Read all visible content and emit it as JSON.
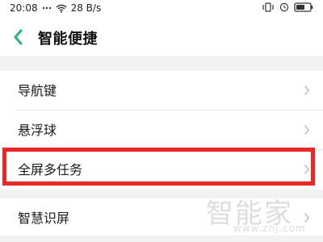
{
  "status_bar": {
    "time": "20:08",
    "network_speed": "28 B/s",
    "icons": [
      "more-dots-icon",
      "wifi-icon",
      "vibrate-icon",
      "alarm-icon",
      "battery-icon"
    ]
  },
  "header": {
    "title": "智能便捷",
    "back_icon": "back-arrow-icon",
    "accent_color": "#20b77a"
  },
  "settings": {
    "group_a": [
      {
        "label": "导航键",
        "name": "nav-key"
      },
      {
        "label": "悬浮球",
        "name": "floating-ball"
      },
      {
        "label": "全屏多任务",
        "name": "fullscreen-multitask",
        "highlighted": true
      }
    ],
    "group_b": [
      {
        "label": "智慧识屏",
        "name": "smart-screen-recognition"
      }
    ]
  },
  "watermark": {
    "brand": "智能家",
    "url": "www.znj.com"
  },
  "colors": {
    "highlight": "#ff1f1f",
    "chevron": "#b8b8b8",
    "background": "#f2f2f2"
  }
}
